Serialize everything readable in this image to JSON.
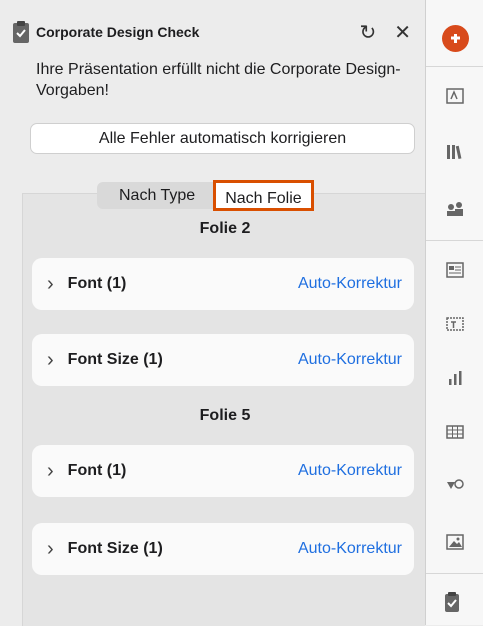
{
  "header": {
    "title": "Corporate Design Check",
    "refresh_icon": "↻",
    "close_icon": "✕"
  },
  "warning": "Ihre Präsentation erfüllt nicht die Corporate Design-Vorgaben!",
  "fix_all_label": "Alle Fehler automatisch korrigieren",
  "tabs": {
    "by_type": "Nach Type",
    "by_slide": "Nach Folie"
  },
  "groups": [
    {
      "title": "Folie 2",
      "items": [
        {
          "label": "Font (1)",
          "action": "Auto-Korrektur"
        },
        {
          "label": "Font Size (1)",
          "action": "Auto-Korrektur"
        }
      ]
    },
    {
      "title": "Folie 5",
      "items": [
        {
          "label": "Font (1)",
          "action": "Auto-Korrektur"
        },
        {
          "label": "Font Size (1)",
          "action": "Auto-Korrektur"
        }
      ]
    }
  ],
  "chevron": "›",
  "colors": {
    "accent": "#d94f00",
    "link": "#1f6fe0",
    "brand": "#d84a1b"
  },
  "sidebar_icons": [
    "brand-logo-icon",
    "text-style-icon",
    "library-icon",
    "people-icon",
    "layout-icon",
    "textbox-icon",
    "chart-icon",
    "table-icon",
    "shapes-icon",
    "image-icon",
    "clipboard-check-icon"
  ]
}
